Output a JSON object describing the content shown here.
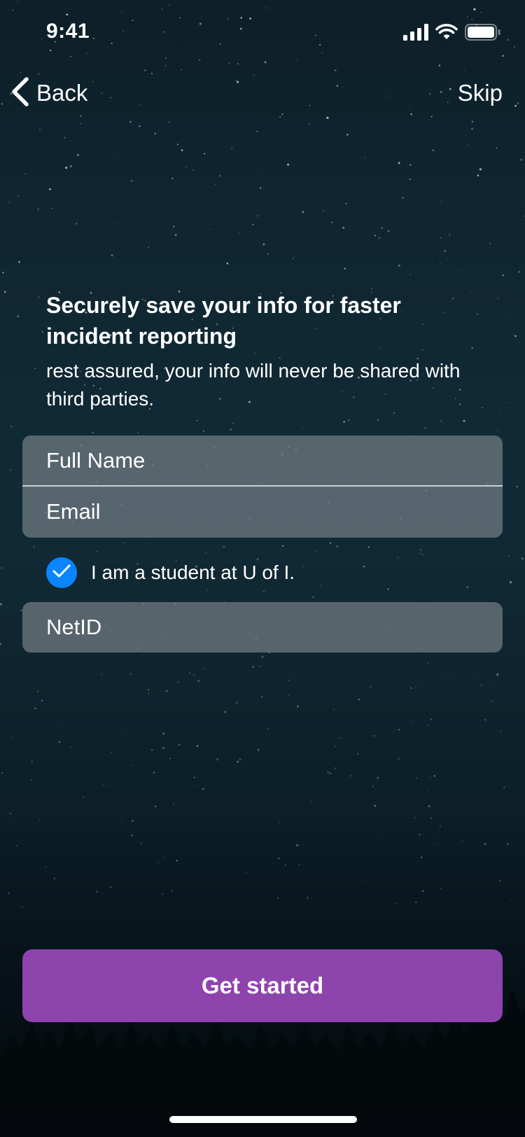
{
  "status_bar": {
    "time": "9:41",
    "icons": [
      "cellular-signal-icon",
      "wifi-icon",
      "battery-icon"
    ]
  },
  "nav": {
    "back_label": "Back",
    "back_icon": "chevron-left-icon",
    "skip_label": "Skip"
  },
  "content": {
    "heading": "Securely save your info for faster incident reporting",
    "subheading": "rest assured, your info will never be shared with third parties."
  },
  "form": {
    "full_name_placeholder": "Full Name",
    "email_placeholder": "Email",
    "student_checkbox": {
      "label": "I am a student at U of I.",
      "checked": true,
      "icon": "checkmark-icon"
    },
    "netid_placeholder": "NetID"
  },
  "actions": {
    "primary_label": "Get started"
  },
  "colors": {
    "accent_blue": "#0a84ff",
    "primary_button": "#8e44ad",
    "field_background": "#6c767e",
    "text": "#ffffff"
  }
}
